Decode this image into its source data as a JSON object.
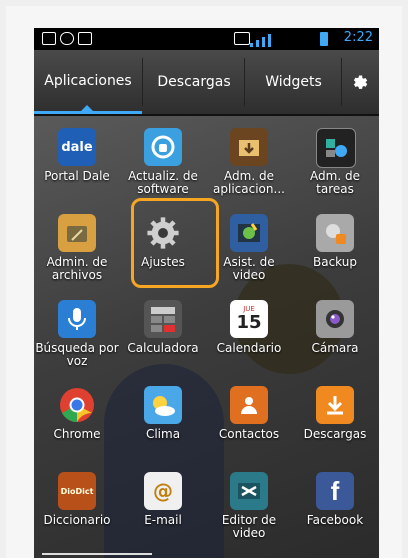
{
  "status_bar": {
    "time": "2:22",
    "accent": "#3fa9f5"
  },
  "tabs": [
    {
      "label": "Aplicaciones"
    },
    {
      "label": "Descargas"
    },
    {
      "label": "Widgets"
    }
  ],
  "settings_icon": "gear-icon",
  "apps": [
    {
      "label": "Portal Dale",
      "icon_text": "dale",
      "color": "#1f5fb5"
    },
    {
      "label": "Actualiz. de software",
      "icon_text": "",
      "color": "#3aa0e0"
    },
    {
      "label": "Adm. de aplicacion...",
      "icon_text": "",
      "color": "#5a3a1a"
    },
    {
      "label": "Adm. de tareas",
      "icon_text": "",
      "color": "#222"
    },
    {
      "label": "Admin. de archivos",
      "icon_text": "",
      "color": "#d8a040"
    },
    {
      "label": "Ajustes",
      "icon_text": "",
      "color": "#888"
    },
    {
      "label": "Asist. de video",
      "icon_text": "",
      "color": "#2f5fa0"
    },
    {
      "label": "Backup",
      "icon_text": "",
      "color": "#aaaaaa"
    },
    {
      "label": "Búsqueda por voz",
      "icon_text": "",
      "color": "#2a7fd4"
    },
    {
      "label": "Calculadora",
      "icon_text": "",
      "color": "#555"
    },
    {
      "label": "Calendario",
      "icon_text": "15",
      "color": "#ffffff"
    },
    {
      "label": "Cámara",
      "icon_text": "",
      "color": "#9a9a9a"
    },
    {
      "label": "Chrome",
      "icon_text": "",
      "color": "#e04030"
    },
    {
      "label": "Clima",
      "icon_text": "",
      "color": "#4aa8e8"
    },
    {
      "label": "Contactos",
      "icon_text": "",
      "color": "#e07020"
    },
    {
      "label": "Descargas",
      "icon_text": "",
      "color": "#f08a20"
    },
    {
      "label": "Diccionario",
      "icon_text": "DioDict",
      "color": "#b8501a"
    },
    {
      "label": "E-mail",
      "icon_text": "@",
      "color": "#f0f0f0"
    },
    {
      "label": "Editor de video",
      "icon_text": "",
      "color": "#2a7a8a"
    },
    {
      "label": "Facebook",
      "icon_text": "f",
      "color": "#3b5998"
    }
  ],
  "calendar_month": "JUE"
}
